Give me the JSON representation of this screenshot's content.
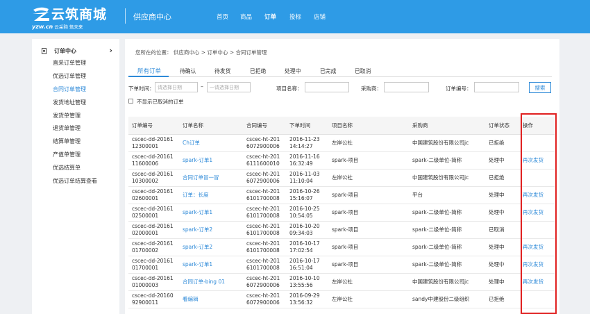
{
  "brand": {
    "logo_text": "云筑商城",
    "domain": "yzw.cn",
    "slogan": "云采购 筑未来",
    "portal_title": "供应商中心"
  },
  "nav": [
    "首页",
    "商品",
    "订单",
    "投标",
    "店铺"
  ],
  "nav_active": "订单",
  "sidebar": {
    "title": "订单中心",
    "items": [
      "直采订单管理",
      "优选订单管理",
      "合同订单管理",
      "发货地址管理",
      "发货单管理",
      "退货单管理",
      "结算单管理",
      "产值单管理",
      "优选结算单",
      "优选订单结算查看"
    ],
    "active_item": "合同订单管理"
  },
  "breadcrumb": "您所在的位置：  供应商中心 > 订单中心 > 合同订单管理",
  "tabs": [
    "所有订单",
    "待确认",
    "待发货",
    "已拒绝",
    "处理中",
    "已完成",
    "已取消"
  ],
  "active_tab": "所有订单",
  "filters": {
    "order_time_label": "下单时间：",
    "date_placeholder": "请选择日期",
    "date_placeholder_end": "一请选择日期",
    "dash": "–",
    "project_label": "项目名称：",
    "buyer_label": "采购商：",
    "order_no_label": "订单编号：",
    "search_label": "搜索",
    "hide_cancelled_label": "不显示已取消的订单"
  },
  "table": {
    "headers": [
      "订单编号",
      "订单名称",
      "合同编号",
      "下单时间",
      "项目名称",
      "采购商",
      "订单状态",
      "操作"
    ],
    "rows": [
      {
        "no1": "cscec-dd-20161",
        "no2": "12300001",
        "name": "Ch订单",
        "c1": "cscec-ht-201",
        "c2": "6072900006",
        "d1": "2016-11-23",
        "d2": "14:14:27",
        "project": "左岸公社",
        "buyer": "中国建筑股份有限公司jc",
        "status": "已拒绝",
        "op": ""
      },
      {
        "no1": "cscec-dd-20161",
        "no2": "11600006",
        "name": "spark-订单1",
        "c1": "cscec-ht-201",
        "c2": "6111600010",
        "d1": "2016-11-16",
        "d2": "16:32:49",
        "project": "spark-项目",
        "buyer": "spark-二级单位-简称",
        "status": "处理中",
        "op": "再次发货"
      },
      {
        "no1": "cscec-dd-20161",
        "no2": "10300002",
        "name": "合同订单冒一冒",
        "c1": "cscec-ht-201",
        "c2": "6072900006",
        "d1": "2016-11-03",
        "d2": "11:10:04",
        "project": "左岸公社",
        "buyer": "中国建筑股份有限公司jc",
        "status": "已拒绝",
        "op": ""
      },
      {
        "no1": "cscec-dd-20161",
        "no2": "02600001",
        "name": "订单：长度",
        "c1": "cscec-ht-201",
        "c2": "6101700008",
        "d1": "2016-10-26",
        "d2": "15:16:07",
        "project": "spark-项目",
        "buyer": "平台",
        "status": "处理中",
        "op": "再次发货"
      },
      {
        "no1": "cscec-dd-20161",
        "no2": "02500001",
        "name": "spark-订单1",
        "c1": "cscec-ht-201",
        "c2": "6101700008",
        "d1": "2016-10-25",
        "d2": "10:54:05",
        "project": "spark-项目",
        "buyer": "spark-二级单位-简称",
        "status": "处理中",
        "op": "再次发货"
      },
      {
        "no1": "cscec-dd-20161",
        "no2": "02000001",
        "name": "spark-订单2",
        "c1": "cscec-ht-201",
        "c2": "6101700008",
        "d1": "2016-10-20",
        "d2": "09:34:03",
        "project": "spark-项目",
        "buyer": "spark-二级单位-简称",
        "status": "已取消",
        "op": ""
      },
      {
        "no1": "cscec-dd-20161",
        "no2": "01700002",
        "name": "spark-订单2",
        "c1": "cscec-ht-201",
        "c2": "6101700008",
        "d1": "2016-10-17",
        "d2": "17:02:54",
        "project": "spark-项目",
        "buyer": "spark-二级单位-简称",
        "status": "处理中",
        "op": "再次发货"
      },
      {
        "no1": "cscec-dd-20161",
        "no2": "01700001",
        "name": "spark-订单1",
        "c1": "cscec-ht-201",
        "c2": "6101700008",
        "d1": "2016-10-17",
        "d2": "16:51:04",
        "project": "spark-项目",
        "buyer": "spark-二级单位-简称",
        "status": "处理中",
        "op": "再次发货"
      },
      {
        "no1": "cscec-dd-20161",
        "no2": "01000003",
        "name": "合同订单-bing 01",
        "c1": "cscec-ht-201",
        "c2": "6072900006",
        "d1": "2016-10-10",
        "d2": "13:55:56",
        "project": "左岸公社",
        "buyer": "中国建筑股份有限公司jc",
        "status": "处理中",
        "op": "再次发货"
      },
      {
        "no1": "cscec-dd-20160",
        "no2": "92900011",
        "name": "看编辑",
        "c1": "cscec-ht-201",
        "c2": "6072900006",
        "d1": "2016-09-29",
        "d2": "13:56:32",
        "project": "左岸公社",
        "buyer": "sandy中建股份二级组织",
        "status": "已拒绝",
        "op": ""
      }
    ]
  },
  "colors": {
    "header_bg": "#2e9be6",
    "link_blue": "#2e8ad8",
    "highlight_red": "#e02020"
  }
}
